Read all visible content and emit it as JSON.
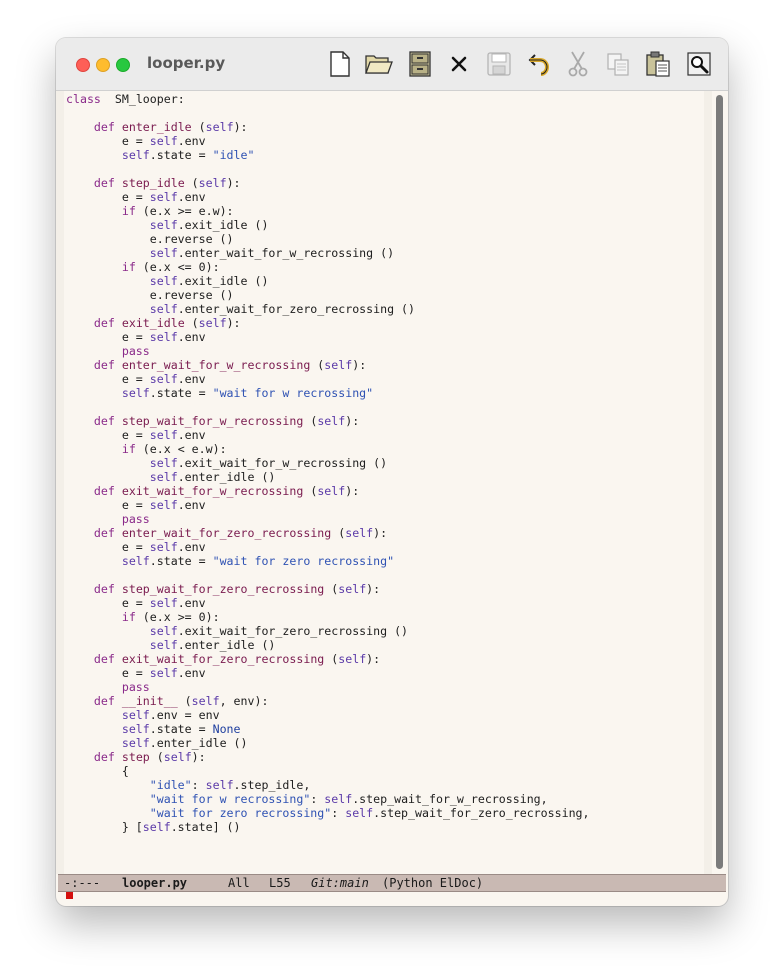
{
  "window": {
    "title": "looper.py"
  },
  "toolbar": {
    "items": [
      {
        "name": "new-file",
        "icon": "document-icon"
      },
      {
        "name": "open-file",
        "icon": "folder-open-icon"
      },
      {
        "name": "dired",
        "icon": "file-cabinet-icon"
      },
      {
        "name": "kill-buffer",
        "icon": "close-x-icon"
      },
      {
        "name": "save",
        "icon": "floppy-disk-icon"
      },
      {
        "name": "undo",
        "icon": "undo-arrow-icon"
      },
      {
        "name": "cut",
        "icon": "scissors-icon"
      },
      {
        "name": "copy",
        "icon": "copy-pages-icon"
      },
      {
        "name": "paste",
        "icon": "clipboard-icon"
      },
      {
        "name": "search",
        "icon": "magnifier-icon"
      }
    ]
  },
  "code": {
    "lines": [
      [
        [
          "kw",
          "class"
        ],
        [
          "",
          "  "
        ],
        [
          "",
          "SM_looper:"
        ]
      ],
      [],
      [
        [
          "",
          "    "
        ],
        [
          "kw",
          "def"
        ],
        [
          "",
          " "
        ],
        [
          "fn",
          "enter_idle"
        ],
        [
          "",
          " ("
        ],
        [
          "sf",
          "self"
        ],
        [
          "",
          "):"
        ]
      ],
      [
        [
          "",
          "        e = "
        ],
        [
          "sf",
          "self"
        ],
        [
          "",
          ".env"
        ]
      ],
      [
        [
          "",
          "        "
        ],
        [
          "sf",
          "self"
        ],
        [
          "",
          ".state = "
        ],
        [
          "st",
          "\"idle\""
        ]
      ],
      [],
      [
        [
          "",
          "    "
        ],
        [
          "kw",
          "def"
        ],
        [
          "",
          " "
        ],
        [
          "fn",
          "step_idle"
        ],
        [
          "",
          " ("
        ],
        [
          "sf",
          "self"
        ],
        [
          "",
          "):"
        ]
      ],
      [
        [
          "",
          "        e = "
        ],
        [
          "sf",
          "self"
        ],
        [
          "",
          ".env"
        ]
      ],
      [
        [
          "",
          "        "
        ],
        [
          "kw",
          "if"
        ],
        [
          "",
          " (e.x >= e.w):"
        ]
      ],
      [
        [
          "",
          "            "
        ],
        [
          "sf",
          "self"
        ],
        [
          "",
          ".exit_idle ()"
        ]
      ],
      [
        [
          "",
          "            e.reverse ()"
        ]
      ],
      [
        [
          "",
          "            "
        ],
        [
          "sf",
          "self"
        ],
        [
          "",
          ".enter_wait_for_w_recrossing ()"
        ]
      ],
      [
        [
          "",
          "        "
        ],
        [
          "kw",
          "if"
        ],
        [
          "",
          " (e.x <= 0):"
        ]
      ],
      [
        [
          "",
          "            "
        ],
        [
          "sf",
          "self"
        ],
        [
          "",
          ".exit_idle ()"
        ]
      ],
      [
        [
          "",
          "            e.reverse ()"
        ]
      ],
      [
        [
          "",
          "            "
        ],
        [
          "sf",
          "self"
        ],
        [
          "",
          ".enter_wait_for_zero_recrossing ()"
        ]
      ],
      [
        [
          "",
          "    "
        ],
        [
          "kw",
          "def"
        ],
        [
          "",
          " "
        ],
        [
          "fn",
          "exit_idle"
        ],
        [
          "",
          " ("
        ],
        [
          "sf",
          "self"
        ],
        [
          "",
          "):"
        ]
      ],
      [
        [
          "",
          "        e = "
        ],
        [
          "sf",
          "self"
        ],
        [
          "",
          ".env"
        ]
      ],
      [
        [
          "",
          "        "
        ],
        [
          "kw",
          "pass"
        ]
      ],
      [
        [
          "",
          "    "
        ],
        [
          "kw",
          "def"
        ],
        [
          "",
          " "
        ],
        [
          "fn",
          "enter_wait_for_w_recrossing"
        ],
        [
          "",
          " ("
        ],
        [
          "sf",
          "self"
        ],
        [
          "",
          "):"
        ]
      ],
      [
        [
          "",
          "        e = "
        ],
        [
          "sf",
          "self"
        ],
        [
          "",
          ".env"
        ]
      ],
      [
        [
          "",
          "        "
        ],
        [
          "sf",
          "self"
        ],
        [
          "",
          ".state = "
        ],
        [
          "st",
          "\"wait for w recrossing\""
        ]
      ],
      [],
      [
        [
          "",
          "    "
        ],
        [
          "kw",
          "def"
        ],
        [
          "",
          " "
        ],
        [
          "fn",
          "step_wait_for_w_recrossing"
        ],
        [
          "",
          " ("
        ],
        [
          "sf",
          "self"
        ],
        [
          "",
          "):"
        ]
      ],
      [
        [
          "",
          "        e = "
        ],
        [
          "sf",
          "self"
        ],
        [
          "",
          ".env"
        ]
      ],
      [
        [
          "",
          "        "
        ],
        [
          "kw",
          "if"
        ],
        [
          "",
          " (e.x < e.w):"
        ]
      ],
      [
        [
          "",
          "            "
        ],
        [
          "sf",
          "self"
        ],
        [
          "",
          ".exit_wait_for_w_recrossing ()"
        ]
      ],
      [
        [
          "",
          "            "
        ],
        [
          "sf",
          "self"
        ],
        [
          "",
          ".enter_idle ()"
        ]
      ],
      [
        [
          "",
          "    "
        ],
        [
          "kw",
          "def"
        ],
        [
          "",
          " "
        ],
        [
          "fn",
          "exit_wait_for_w_recrossing"
        ],
        [
          "",
          " ("
        ],
        [
          "sf",
          "self"
        ],
        [
          "",
          "):"
        ]
      ],
      [
        [
          "",
          "        e = "
        ],
        [
          "sf",
          "self"
        ],
        [
          "",
          ".env"
        ]
      ],
      [
        [
          "",
          "        "
        ],
        [
          "kw",
          "pass"
        ]
      ],
      [
        [
          "",
          "    "
        ],
        [
          "kw",
          "def"
        ],
        [
          "",
          " "
        ],
        [
          "fn",
          "enter_wait_for_zero_recrossing"
        ],
        [
          "",
          " ("
        ],
        [
          "sf",
          "self"
        ],
        [
          "",
          "):"
        ]
      ],
      [
        [
          "",
          "        e = "
        ],
        [
          "sf",
          "self"
        ],
        [
          "",
          ".env"
        ]
      ],
      [
        [
          "",
          "        "
        ],
        [
          "sf",
          "self"
        ],
        [
          "",
          ".state = "
        ],
        [
          "st",
          "\"wait for zero recrossing\""
        ]
      ],
      [],
      [
        [
          "",
          "    "
        ],
        [
          "kw",
          "def"
        ],
        [
          "",
          " "
        ],
        [
          "fn",
          "step_wait_for_zero_recrossing"
        ],
        [
          "",
          " ("
        ],
        [
          "sf",
          "self"
        ],
        [
          "",
          "):"
        ]
      ],
      [
        [
          "",
          "        e = "
        ],
        [
          "sf",
          "self"
        ],
        [
          "",
          ".env"
        ]
      ],
      [
        [
          "",
          "        "
        ],
        [
          "kw",
          "if"
        ],
        [
          "",
          " (e.x >= 0):"
        ]
      ],
      [
        [
          "",
          "            "
        ],
        [
          "sf",
          "self"
        ],
        [
          "",
          ".exit_wait_for_zero_recrossing ()"
        ]
      ],
      [
        [
          "",
          "            "
        ],
        [
          "sf",
          "self"
        ],
        [
          "",
          ".enter_idle ()"
        ]
      ],
      [
        [
          "",
          "    "
        ],
        [
          "kw",
          "def"
        ],
        [
          "",
          " "
        ],
        [
          "fn",
          "exit_wait_for_zero_recrossing"
        ],
        [
          "",
          " ("
        ],
        [
          "sf",
          "self"
        ],
        [
          "",
          "):"
        ]
      ],
      [
        [
          "",
          "        e = "
        ],
        [
          "sf",
          "self"
        ],
        [
          "",
          ".env"
        ]
      ],
      [
        [
          "",
          "        "
        ],
        [
          "kw",
          "pass"
        ]
      ],
      [
        [
          "",
          "    "
        ],
        [
          "kw",
          "def"
        ],
        [
          "",
          " "
        ],
        [
          "fn",
          "__init__"
        ],
        [
          "",
          " ("
        ],
        [
          "sf",
          "self"
        ],
        [
          "",
          ", env):"
        ]
      ],
      [
        [
          "",
          "        "
        ],
        [
          "sf",
          "self"
        ],
        [
          "",
          ".env = env"
        ]
      ],
      [
        [
          "",
          "        "
        ],
        [
          "sf",
          "self"
        ],
        [
          "",
          ".state = "
        ],
        [
          "bi",
          "None"
        ]
      ],
      [
        [
          "",
          "        "
        ],
        [
          "sf",
          "self"
        ],
        [
          "",
          ".enter_idle ()"
        ]
      ],
      [
        [
          "",
          "    "
        ],
        [
          "kw",
          "def"
        ],
        [
          "",
          " "
        ],
        [
          "fn",
          "step"
        ],
        [
          "",
          " ("
        ],
        [
          "sf",
          "self"
        ],
        [
          "",
          "):"
        ]
      ],
      [
        [
          "",
          "        {"
        ]
      ],
      [
        [
          "",
          "            "
        ],
        [
          "st",
          "\"idle\""
        ],
        [
          "",
          ": "
        ],
        [
          "sf",
          "self"
        ],
        [
          "",
          ".step_idle,"
        ]
      ],
      [
        [
          "",
          "            "
        ],
        [
          "st",
          "\"wait for w recrossing\""
        ],
        [
          "",
          ": "
        ],
        [
          "sf",
          "self"
        ],
        [
          "",
          ".step_wait_for_w_recrossing,"
        ]
      ],
      [
        [
          "",
          "            "
        ],
        [
          "st",
          "\"wait for zero recrossing\""
        ],
        [
          "",
          ": "
        ],
        [
          "sf",
          "self"
        ],
        [
          "",
          ".step_wait_for_zero_recrossing,"
        ]
      ],
      [
        [
          "",
          "        } ["
        ],
        [
          "sf",
          "self"
        ],
        [
          "",
          ".state] ()"
        ]
      ]
    ]
  },
  "modeline": {
    "status": "-:---",
    "buffer": "looper.py",
    "position": "All",
    "line": "L55",
    "vc": "Git:main",
    "modes": "(Python ElDoc)"
  },
  "colors": {
    "keyword": "#8a2a8a",
    "function": "#7a1b4f",
    "self": "#5b3aa8",
    "string": "#2f52b3",
    "cursor": "#d4100f",
    "modeline_bg": "#c9b9b3",
    "buffer_bg": "#faf6f0"
  }
}
